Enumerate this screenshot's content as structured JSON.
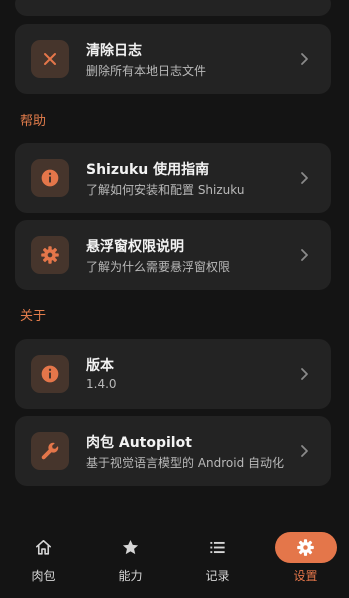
{
  "colors": {
    "background": "#141414",
    "card": "#232323",
    "accent": "#e4764a",
    "icon_bg": "#46352c"
  },
  "items": {
    "clear_logs": {
      "title": "清除日志",
      "subtitle": "删除所有本地日志文件",
      "icon": "close-icon"
    },
    "shizuku_guide": {
      "title": "Shizuku 使用指南",
      "subtitle": "了解如何安装和配置 Shizuku",
      "icon": "info-icon"
    },
    "overlay_permission": {
      "title": "悬浮窗权限说明",
      "subtitle": "了解为什么需要悬浮窗权限",
      "icon": "gear-icon"
    },
    "version": {
      "title": "版本",
      "subtitle": "1.4.0",
      "icon": "info-icon"
    },
    "about_app": {
      "title": "肉包 Autopilot",
      "subtitle": "基于视觉语言模型的 Android 自动化",
      "icon": "wrench-icon"
    }
  },
  "sections": {
    "help": "帮助",
    "about": "关于"
  },
  "nav": {
    "home": {
      "label": "肉包",
      "icon": "home-icon"
    },
    "abilities": {
      "label": "能力",
      "icon": "star-icon"
    },
    "records": {
      "label": "记录",
      "icon": "list-icon"
    },
    "settings": {
      "label": "设置",
      "icon": "gear-icon",
      "active": true
    }
  }
}
